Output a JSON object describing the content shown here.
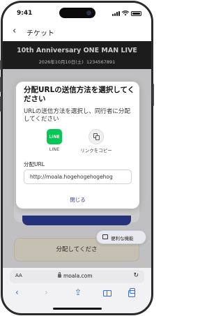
{
  "status_bar": {
    "time": "9:41"
  },
  "nav": {
    "back_icon": "‹",
    "title": "チケット"
  },
  "event": {
    "title": "10th Anniversary ONE MAN LIVE",
    "date": "2026年10月10日(土)",
    "ticket_number": "1234567891"
  },
  "background": {
    "distribute_text": "分配してくださ"
  },
  "modal": {
    "title": "分配URLの送信方法を選択してください",
    "description": "URLの送信方法を選択し、同行者に分配してください",
    "options": [
      {
        "label": "LINE",
        "icon": "line-icon",
        "icon_text": "LINE",
        "color": "#06c755"
      },
      {
        "label": "リンクをコピー",
        "icon": "copy-icon"
      }
    ],
    "url_label": "分配URL",
    "url_value": "http://moala.hogehogehogehog",
    "close_label": "閉じる"
  },
  "convenient_button": {
    "label": "便利な機能"
  },
  "browser": {
    "aa_label": "AA",
    "domain": "moala.com",
    "reload_icon": "↻",
    "toolbar": {
      "back_icon": "‹",
      "forward_icon": "›",
      "share_icon": "⇪"
    }
  },
  "colors": {
    "accent": "#2e3f9a",
    "line_green": "#06c755",
    "safari_blue": "#2f6de1"
  }
}
